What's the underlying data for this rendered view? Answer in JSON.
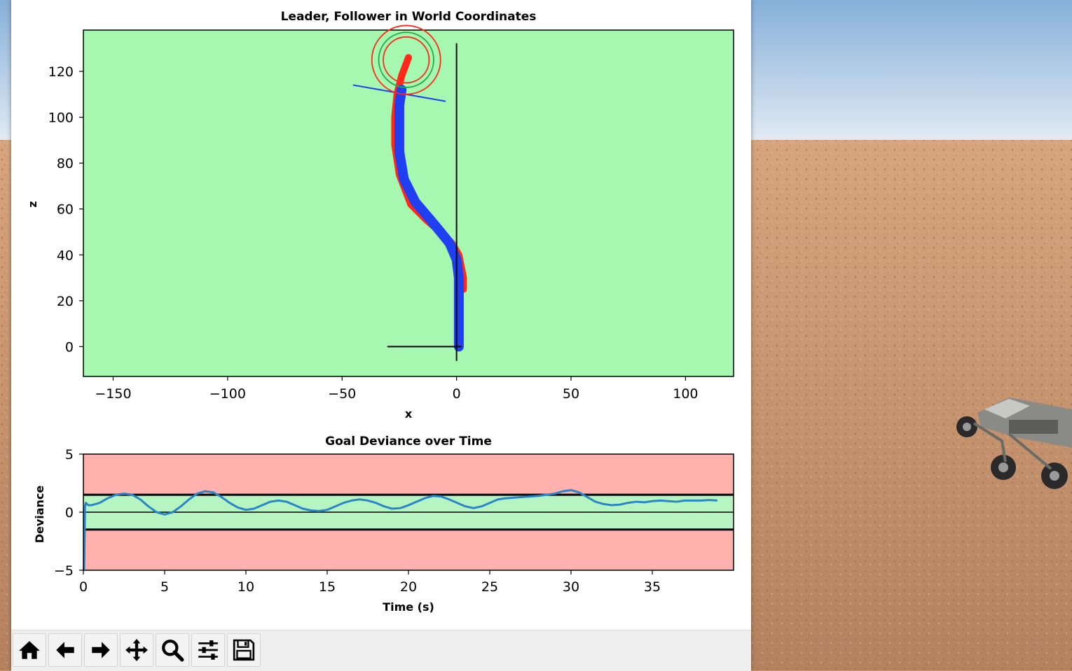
{
  "scene": {
    "sky_top": "#8fb6dd",
    "sky_horizon": "#e6eef6",
    "ground": "#c69670",
    "ground_dark": "#a9754f"
  },
  "top_plot": {
    "title": "Leader, Follower in World Coordinates",
    "xlabel": "x",
    "ylabel": "z",
    "bg_color": "#a6f7b0",
    "xticks": [
      "−150",
      "−100",
      "−50",
      "0",
      "50",
      "100"
    ],
    "yticks": [
      "120",
      "100",
      "80",
      "60",
      "40",
      "20",
      "0"
    ]
  },
  "bottom_plot": {
    "title": "Goal Deviance over Time",
    "xlabel": "Time (s)",
    "ylabel": "Deviance",
    "outer_color": "#ffb2ad",
    "inner_color": "#b6f5c2",
    "xticks": [
      "0",
      "5",
      "10",
      "15",
      "20",
      "25",
      "30",
      "35"
    ],
    "yticks": [
      "5",
      "0",
      "−5"
    ]
  },
  "chart_data": [
    {
      "type": "line",
      "title": "Leader, Follower in World Coordinates",
      "xlabel": "x",
      "ylabel": "z",
      "xlim": [
        -163,
        121
      ],
      "ylim": [
        -13,
        138
      ],
      "series": [
        {
          "color": "#ff2a1a",
          "x": [
            3,
            3,
            2,
            1,
            -2,
            -7,
            -13,
            -20,
            -25,
            -27,
            -27,
            -26,
            -24,
            -21
          ],
          "y": [
            25,
            30,
            35,
            40,
            45,
            50,
            55,
            62,
            75,
            88,
            100,
            110,
            118,
            126
          ]
        },
        {
          "color": "#1f3ff0",
          "x": [
            1,
            1,
            1,
            1,
            0,
            -3,
            -7,
            -12,
            -18,
            -23,
            -25,
            -25,
            -25,
            -24
          ],
          "y": [
            0,
            10,
            20,
            30,
            38,
            45,
            50,
            56,
            63,
            73,
            85,
            97,
            105,
            112
          ]
        },
        {
          "color": "#1f3ff0",
          "x": [
            -45,
            -5
          ],
          "y": [
            114,
            107
          ]
        },
        {
          "color": "#000000",
          "x": [
            0,
            0
          ],
          "y": [
            -6,
            132
          ]
        },
        {
          "color": "#000000",
          "x": [
            -30,
            2
          ],
          "y": [
            0,
            0
          ]
        }
      ],
      "circles": [
        {
          "color": "#ff2a1a",
          "cx": -22,
          "cy": 125,
          "r": 15
        },
        {
          "color": "#27a84a",
          "cx": -22,
          "cy": 125,
          "r": 12
        },
        {
          "color": "#ff2a1a",
          "cx": -22,
          "cy": 125,
          "r": 10
        }
      ]
    },
    {
      "type": "line",
      "title": "Goal Deviance over Time",
      "xlabel": "Time (s)",
      "ylabel": "Deviance",
      "xlim": [
        0,
        40
      ],
      "ylim": [
        -5,
        5
      ],
      "bands": {
        "upper": 1.5,
        "lower": -1.5
      },
      "series": [
        {
          "color": "#2b86c8",
          "x": [
            0,
            0.05,
            0.1,
            0.15,
            0.3,
            0.5,
            1.0,
            1.5,
            2.0,
            2.5,
            3.0,
            3.5,
            4.0,
            4.5,
            5.0,
            5.5,
            6.0,
            6.5,
            7.0,
            7.5,
            8.0,
            8.5,
            9.0,
            9.5,
            10.0,
            10.5,
            11.0,
            11.5,
            12.0,
            12.5,
            13.0,
            13.5,
            14.0,
            14.5,
            15.0,
            15.5,
            16.0,
            16.5,
            17.0,
            17.5,
            18.0,
            18.5,
            19.0,
            19.5,
            20.0,
            20.5,
            21.0,
            21.5,
            22.0,
            22.5,
            23.0,
            23.5,
            24.0,
            24.5,
            25.0,
            25.5,
            26.0,
            26.5,
            27.0,
            27.5,
            28.0,
            28.5,
            29.0,
            29.5,
            30.0,
            30.5,
            31.0,
            31.5,
            32.0,
            32.5,
            33.0,
            33.5,
            34.0,
            34.5,
            35.0,
            35.5,
            36.0,
            36.5,
            37.0,
            37.5,
            38.0,
            38.5,
            39.0
          ],
          "values": [
            -5,
            -4.8,
            0.5,
            0.8,
            0.6,
            0.6,
            0.8,
            1.2,
            1.5,
            1.6,
            1.5,
            1.1,
            0.5,
            0.0,
            -0.2,
            0.0,
            0.5,
            1.1,
            1.6,
            1.8,
            1.7,
            1.3,
            0.8,
            0.4,
            0.2,
            0.3,
            0.6,
            0.9,
            1.0,
            0.9,
            0.6,
            0.3,
            0.15,
            0.1,
            0.2,
            0.5,
            0.8,
            1.0,
            1.1,
            1.0,
            0.8,
            0.5,
            0.3,
            0.35,
            0.6,
            0.9,
            1.2,
            1.4,
            1.35,
            1.1,
            0.8,
            0.5,
            0.35,
            0.5,
            0.8,
            1.1,
            1.2,
            1.25,
            1.3,
            1.35,
            1.4,
            1.5,
            1.6,
            1.8,
            1.9,
            1.7,
            1.3,
            0.9,
            0.7,
            0.6,
            0.65,
            0.8,
            0.9,
            0.85,
            0.95,
            1.0,
            0.95,
            0.9,
            1.0,
            1.0,
            1.0,
            1.05,
            1.0
          ]
        }
      ]
    }
  ],
  "toolbar": {
    "buttons": [
      {
        "name": "home",
        "icon": "home-icon"
      },
      {
        "name": "back",
        "icon": "arrow-left-icon"
      },
      {
        "name": "forward",
        "icon": "arrow-right-icon"
      },
      {
        "name": "pan",
        "icon": "move-icon"
      },
      {
        "name": "zoom",
        "icon": "magnifier-icon"
      },
      {
        "name": "configure-subplots",
        "icon": "sliders-icon"
      },
      {
        "name": "save",
        "icon": "floppy-disk-icon"
      }
    ]
  }
}
